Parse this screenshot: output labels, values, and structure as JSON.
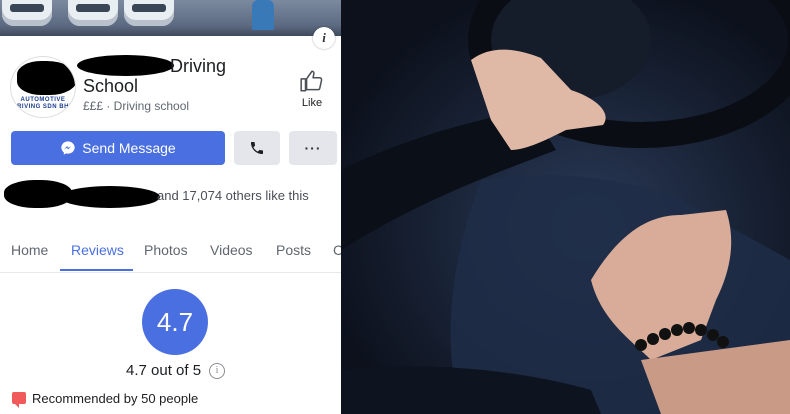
{
  "profile": {
    "name_line1": "Driving",
    "name_line2": "School",
    "category": "£££ · Driving school",
    "logo_text": "AUTOMOTIVE DRIVING SDN BHD",
    "info_label": "i"
  },
  "actions": {
    "like_label": "Like",
    "send_message": "Send Message",
    "more_label": "···"
  },
  "social": {
    "likes_text": "and 17,074 others like this"
  },
  "tabs": [
    {
      "label": "Home"
    },
    {
      "label": "Reviews"
    },
    {
      "label": "Photos"
    },
    {
      "label": "Videos"
    },
    {
      "label": "Posts"
    },
    {
      "label": "C"
    }
  ],
  "reviews": {
    "rating": "4.7",
    "rating_text": "4.7 out of 5",
    "info_label": "i",
    "recommended": "Recommended by 50 people"
  },
  "colors": {
    "accent": "#4a6fe0",
    "recommend": "#f05a5a"
  },
  "icons": {
    "like": "thumbs-up-icon",
    "messenger": "messenger-icon",
    "phone": "phone-icon",
    "info": "info-icon"
  }
}
